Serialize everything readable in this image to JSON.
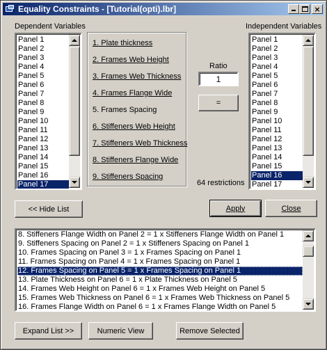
{
  "window": {
    "title": "Equality Constraints - [Tutorial(opti).lbr]",
    "controls": {
      "minimize": "_",
      "maximize": "□",
      "close": "×"
    }
  },
  "dependent": {
    "label": "Dependent Variables",
    "items": [
      "Panel 1",
      "Panel 2",
      "Panel 3",
      "Panel 4",
      "Panel 5",
      "Panel 6",
      "Panel 7",
      "Panel 8",
      "Panel 9",
      "Panel 10",
      "Panel 11",
      "Panel 12",
      "Panel 13",
      "Panel 14",
      "Panel 15",
      "Panel 16",
      "Panel 17"
    ],
    "selected": "Panel 17"
  },
  "independent": {
    "label": "Independent Variables",
    "items": [
      "Panel 1",
      "Panel 2",
      "Panel 3",
      "Panel 4",
      "Panel 5",
      "Panel 6",
      "Panel 7",
      "Panel 8",
      "Panel 9",
      "Panel 10",
      "Panel 11",
      "Panel 12",
      "Panel 13",
      "Panel 14",
      "Panel 15",
      "Panel 16",
      "Panel 17"
    ],
    "selected": "Panel 16"
  },
  "properties": [
    {
      "label": "1. Plate thickness",
      "link": true
    },
    {
      "label": "2. Frames Web Height",
      "link": true
    },
    {
      "label": "3. Frames Web Thickness",
      "link": true
    },
    {
      "label": "4. Frames Flange Wide",
      "link": true
    },
    {
      "label": "5. Frames Spacing",
      "link": false
    },
    {
      "label": "6. Stiffeners Web Height",
      "link": true
    },
    {
      "label": "7. Stiffeners Web Thickness",
      "link": true
    },
    {
      "label": "8. Stiffeners Flange Wide",
      "link": true
    },
    {
      "label": "9. Stiffeners Spacing",
      "link": true
    }
  ],
  "ratio": {
    "label": "Ratio",
    "value": "1",
    "equals_button": "="
  },
  "restrictions_count": "64 restrictions",
  "buttons": {
    "hide_list": "<< Hide List",
    "apply": "Apply",
    "close": "Close",
    "expand_list": "Expand List >>",
    "numeric_view": "Numeric View",
    "remove_selected": "Remove Selected"
  },
  "constraints": {
    "items": [
      "8. Stiffeners Flange Width on Panel 2 = 1 x Stiffeners Flange Width on Panel 1",
      "9. Stiffeners Spacing on Panel 2 = 1 x Stiffeners Spacing on Panel 1",
      "10. Frames Spacing on Panel 3 = 1 x Frames Spacing on Panel 1",
      "11. Frames Spacing on Panel 4 = 1 x Frames Spacing on Panel 1",
      "12. Frames Spacing on Panel 5 = 1 x Frames Spacing on Panel 1",
      "13. Plate Thickness on Panel 6 = 1 x Plate Thickness on Panel 5",
      "14. Frames Web Height on Panel 6 = 1 x Frames Web Height on Panel 5",
      "15. Frames Web Thickness on Panel 6 = 1 x Frames Web Thickness on Panel 5",
      "16. Frames Flange Width on Panel 6 = 1 x Frames Flange Width on Panel 5"
    ],
    "selected_index": 4
  }
}
